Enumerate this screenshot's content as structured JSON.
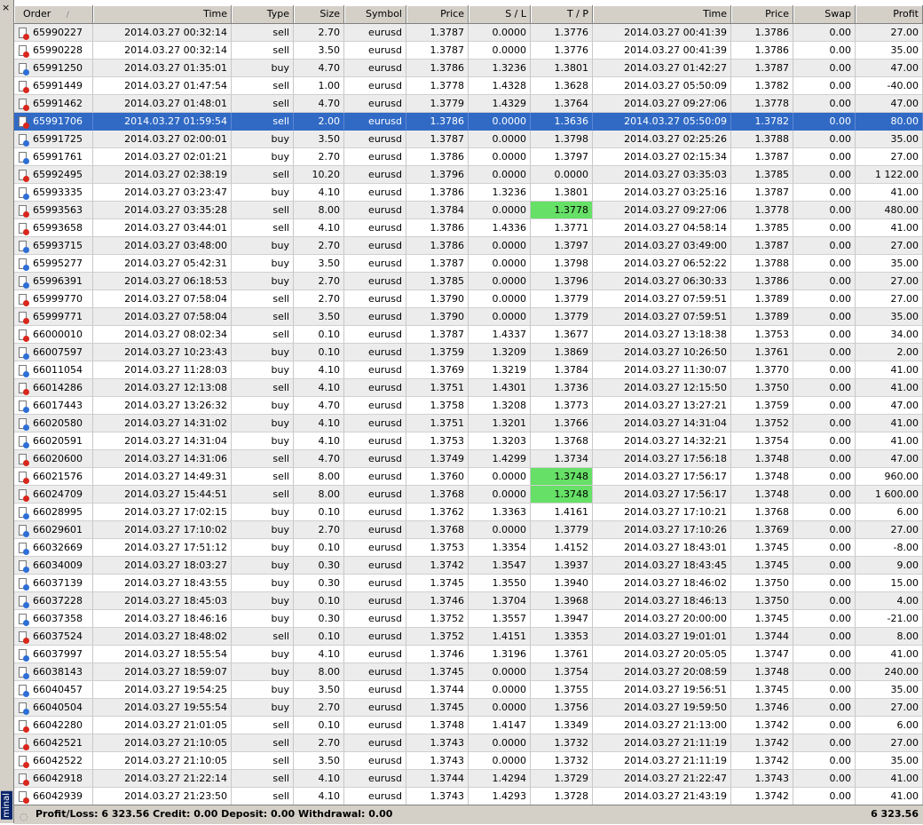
{
  "sidebar": {
    "close_glyph": "×",
    "label": "minal"
  },
  "table": {
    "headers": {
      "order": "Order",
      "sort_glyph": "/",
      "time": "Time",
      "type": "Type",
      "size": "Size",
      "symbol": "Symbol",
      "price": "Price",
      "sl": "S / L",
      "tp": "T / P",
      "close_time": "Time",
      "close_price": "Price",
      "swap": "Swap",
      "profit": "Profit"
    },
    "rows": [
      {
        "order": "65990227",
        "time": "2014.03.27 00:32:14",
        "type": "sell",
        "size": "2.70",
        "symbol": "eurusd",
        "price": "1.3787",
        "sl": "0.0000",
        "tp": "1.3776",
        "close_time": "2014.03.27 00:41:39",
        "close_price": "1.3786",
        "swap": "0.00",
        "profit": "27.00"
      },
      {
        "order": "65990228",
        "time": "2014.03.27 00:32:14",
        "type": "sell",
        "size": "3.50",
        "symbol": "eurusd",
        "price": "1.3787",
        "sl": "0.0000",
        "tp": "1.3776",
        "close_time": "2014.03.27 00:41:39",
        "close_price": "1.3786",
        "swap": "0.00",
        "profit": "35.00"
      },
      {
        "order": "65991250",
        "time": "2014.03.27 01:35:01",
        "type": "buy",
        "size": "4.70",
        "symbol": "eurusd",
        "price": "1.3786",
        "sl": "1.3236",
        "tp": "1.3801",
        "close_time": "2014.03.27 01:42:27",
        "close_price": "1.3787",
        "swap": "0.00",
        "profit": "47.00"
      },
      {
        "order": "65991449",
        "time": "2014.03.27 01:47:54",
        "type": "sell",
        "size": "1.00",
        "symbol": "eurusd",
        "price": "1.3778",
        "sl": "1.4328",
        "tp": "1.3628",
        "close_time": "2014.03.27 05:50:09",
        "close_price": "1.3782",
        "swap": "0.00",
        "profit": "-40.00"
      },
      {
        "order": "65991462",
        "time": "2014.03.27 01:48:01",
        "type": "sell",
        "size": "4.70",
        "symbol": "eurusd",
        "price": "1.3779",
        "sl": "1.4329",
        "tp": "1.3764",
        "close_time": "2014.03.27 09:27:06",
        "close_price": "1.3778",
        "swap": "0.00",
        "profit": "47.00"
      },
      {
        "order": "65991706",
        "time": "2014.03.27 01:59:54",
        "type": "sell",
        "size": "2.00",
        "symbol": "eurusd",
        "price": "1.3786",
        "sl": "0.0000",
        "tp": "1.3636",
        "close_time": "2014.03.27 05:50:09",
        "close_price": "1.3782",
        "swap": "0.00",
        "profit": "80.00",
        "selected": true
      },
      {
        "order": "65991725",
        "time": "2014.03.27 02:00:01",
        "type": "buy",
        "size": "3.50",
        "symbol": "eurusd",
        "price": "1.3787",
        "sl": "0.0000",
        "tp": "1.3798",
        "close_time": "2014.03.27 02:25:26",
        "close_price": "1.3788",
        "swap": "0.00",
        "profit": "35.00"
      },
      {
        "order": "65991761",
        "time": "2014.03.27 02:01:21",
        "type": "buy",
        "size": "2.70",
        "symbol": "eurusd",
        "price": "1.3786",
        "sl": "0.0000",
        "tp": "1.3797",
        "close_time": "2014.03.27 02:15:34",
        "close_price": "1.3787",
        "swap": "0.00",
        "profit": "27.00"
      },
      {
        "order": "65992495",
        "time": "2014.03.27 02:38:19",
        "type": "sell",
        "size": "10.20",
        "symbol": "eurusd",
        "price": "1.3796",
        "sl": "0.0000",
        "tp": "0.0000",
        "close_time": "2014.03.27 03:35:03",
        "close_price": "1.3785",
        "swap": "0.00",
        "profit": "1 122.00"
      },
      {
        "order": "65993335",
        "time": "2014.03.27 03:23:47",
        "type": "buy",
        "size": "4.10",
        "symbol": "eurusd",
        "price": "1.3786",
        "sl": "1.3236",
        "tp": "1.3801",
        "close_time": "2014.03.27 03:25:16",
        "close_price": "1.3787",
        "swap": "0.00",
        "profit": "41.00"
      },
      {
        "order": "65993563",
        "time": "2014.03.27 03:35:28",
        "type": "sell",
        "size": "8.00",
        "symbol": "eurusd",
        "price": "1.3784",
        "sl": "0.0000",
        "tp": "1.3778",
        "close_time": "2014.03.27 09:27:06",
        "close_price": "1.3778",
        "swap": "0.00",
        "profit": "480.00",
        "tp_hit": true
      },
      {
        "order": "65993658",
        "time": "2014.03.27 03:44:01",
        "type": "sell",
        "size": "4.10",
        "symbol": "eurusd",
        "price": "1.3786",
        "sl": "1.4336",
        "tp": "1.3771",
        "close_time": "2014.03.27 04:58:14",
        "close_price": "1.3785",
        "swap": "0.00",
        "profit": "41.00"
      },
      {
        "order": "65993715",
        "time": "2014.03.27 03:48:00",
        "type": "buy",
        "size": "2.70",
        "symbol": "eurusd",
        "price": "1.3786",
        "sl": "0.0000",
        "tp": "1.3797",
        "close_time": "2014.03.27 03:49:00",
        "close_price": "1.3787",
        "swap": "0.00",
        "profit": "27.00"
      },
      {
        "order": "65995277",
        "time": "2014.03.27 05:42:31",
        "type": "buy",
        "size": "3.50",
        "symbol": "eurusd",
        "price": "1.3787",
        "sl": "0.0000",
        "tp": "1.3798",
        "close_time": "2014.03.27 06:52:22",
        "close_price": "1.3788",
        "swap": "0.00",
        "profit": "35.00"
      },
      {
        "order": "65996391",
        "time": "2014.03.27 06:18:53",
        "type": "buy",
        "size": "2.70",
        "symbol": "eurusd",
        "price": "1.3785",
        "sl": "0.0000",
        "tp": "1.3796",
        "close_time": "2014.03.27 06:30:33",
        "close_price": "1.3786",
        "swap": "0.00",
        "profit": "27.00"
      },
      {
        "order": "65999770",
        "time": "2014.03.27 07:58:04",
        "type": "sell",
        "size": "2.70",
        "symbol": "eurusd",
        "price": "1.3790",
        "sl": "0.0000",
        "tp": "1.3779",
        "close_time": "2014.03.27 07:59:51",
        "close_price": "1.3789",
        "swap": "0.00",
        "profit": "27.00"
      },
      {
        "order": "65999771",
        "time": "2014.03.27 07:58:04",
        "type": "sell",
        "size": "3.50",
        "symbol": "eurusd",
        "price": "1.3790",
        "sl": "0.0000",
        "tp": "1.3779",
        "close_time": "2014.03.27 07:59:51",
        "close_price": "1.3789",
        "swap": "0.00",
        "profit": "35.00"
      },
      {
        "order": "66000010",
        "time": "2014.03.27 08:02:34",
        "type": "sell",
        "size": "0.10",
        "symbol": "eurusd",
        "price": "1.3787",
        "sl": "1.4337",
        "tp": "1.3677",
        "close_time": "2014.03.27 13:18:38",
        "close_price": "1.3753",
        "swap": "0.00",
        "profit": "34.00"
      },
      {
        "order": "66007597",
        "time": "2014.03.27 10:23:43",
        "type": "buy",
        "size": "0.10",
        "symbol": "eurusd",
        "price": "1.3759",
        "sl": "1.3209",
        "tp": "1.3869",
        "close_time": "2014.03.27 10:26:50",
        "close_price": "1.3761",
        "swap": "0.00",
        "profit": "2.00"
      },
      {
        "order": "66011054",
        "time": "2014.03.27 11:28:03",
        "type": "buy",
        "size": "4.10",
        "symbol": "eurusd",
        "price": "1.3769",
        "sl": "1.3219",
        "tp": "1.3784",
        "close_time": "2014.03.27 11:30:07",
        "close_price": "1.3770",
        "swap": "0.00",
        "profit": "41.00"
      },
      {
        "order": "66014286",
        "time": "2014.03.27 12:13:08",
        "type": "sell",
        "size": "4.10",
        "symbol": "eurusd",
        "price": "1.3751",
        "sl": "1.4301",
        "tp": "1.3736",
        "close_time": "2014.03.27 12:15:50",
        "close_price": "1.3750",
        "swap": "0.00",
        "profit": "41.00"
      },
      {
        "order": "66017443",
        "time": "2014.03.27 13:26:32",
        "type": "buy",
        "size": "4.70",
        "symbol": "eurusd",
        "price": "1.3758",
        "sl": "1.3208",
        "tp": "1.3773",
        "close_time": "2014.03.27 13:27:21",
        "close_price": "1.3759",
        "swap": "0.00",
        "profit": "47.00"
      },
      {
        "order": "66020580",
        "time": "2014.03.27 14:31:02",
        "type": "buy",
        "size": "4.10",
        "symbol": "eurusd",
        "price": "1.3751",
        "sl": "1.3201",
        "tp": "1.3766",
        "close_time": "2014.03.27 14:31:04",
        "close_price": "1.3752",
        "swap": "0.00",
        "profit": "41.00"
      },
      {
        "order": "66020591",
        "time": "2014.03.27 14:31:04",
        "type": "buy",
        "size": "4.10",
        "symbol": "eurusd",
        "price": "1.3753",
        "sl": "1.3203",
        "tp": "1.3768",
        "close_time": "2014.03.27 14:32:21",
        "close_price": "1.3754",
        "swap": "0.00",
        "profit": "41.00"
      },
      {
        "order": "66020600",
        "time": "2014.03.27 14:31:06",
        "type": "sell",
        "size": "4.70",
        "symbol": "eurusd",
        "price": "1.3749",
        "sl": "1.4299",
        "tp": "1.3734",
        "close_time": "2014.03.27 17:56:18",
        "close_price": "1.3748",
        "swap": "0.00",
        "profit": "47.00"
      },
      {
        "order": "66021576",
        "time": "2014.03.27 14:49:31",
        "type": "sell",
        "size": "8.00",
        "symbol": "eurusd",
        "price": "1.3760",
        "sl": "0.0000",
        "tp": "1.3748",
        "close_time": "2014.03.27 17:56:17",
        "close_price": "1.3748",
        "swap": "0.00",
        "profit": "960.00",
        "tp_hit": true
      },
      {
        "order": "66024709",
        "time": "2014.03.27 15:44:51",
        "type": "sell",
        "size": "8.00",
        "symbol": "eurusd",
        "price": "1.3768",
        "sl": "0.0000",
        "tp": "1.3748",
        "close_time": "2014.03.27 17:56:17",
        "close_price": "1.3748",
        "swap": "0.00",
        "profit": "1 600.00",
        "tp_hit": true
      },
      {
        "order": "66028995",
        "time": "2014.03.27 17:02:15",
        "type": "buy",
        "size": "0.10",
        "symbol": "eurusd",
        "price": "1.3762",
        "sl": "1.3363",
        "tp": "1.4161",
        "close_time": "2014.03.27 17:10:21",
        "close_price": "1.3768",
        "swap": "0.00",
        "profit": "6.00"
      },
      {
        "order": "66029601",
        "time": "2014.03.27 17:10:02",
        "type": "buy",
        "size": "2.70",
        "symbol": "eurusd",
        "price": "1.3768",
        "sl": "0.0000",
        "tp": "1.3779",
        "close_time": "2014.03.27 17:10:26",
        "close_price": "1.3769",
        "swap": "0.00",
        "profit": "27.00"
      },
      {
        "order": "66032669",
        "time": "2014.03.27 17:51:12",
        "type": "buy",
        "size": "0.10",
        "symbol": "eurusd",
        "price": "1.3753",
        "sl": "1.3354",
        "tp": "1.4152",
        "close_time": "2014.03.27 18:43:01",
        "close_price": "1.3745",
        "swap": "0.00",
        "profit": "-8.00"
      },
      {
        "order": "66034009",
        "time": "2014.03.27 18:03:27",
        "type": "buy",
        "size": "0.30",
        "symbol": "eurusd",
        "price": "1.3742",
        "sl": "1.3547",
        "tp": "1.3937",
        "close_time": "2014.03.27 18:43:45",
        "close_price": "1.3745",
        "swap": "0.00",
        "profit": "9.00"
      },
      {
        "order": "66037139",
        "time": "2014.03.27 18:43:55",
        "type": "buy",
        "size": "0.30",
        "symbol": "eurusd",
        "price": "1.3745",
        "sl": "1.3550",
        "tp": "1.3940",
        "close_time": "2014.03.27 18:46:02",
        "close_price": "1.3750",
        "swap": "0.00",
        "profit": "15.00"
      },
      {
        "order": "66037228",
        "time": "2014.03.27 18:45:03",
        "type": "buy",
        "size": "0.10",
        "symbol": "eurusd",
        "price": "1.3746",
        "sl": "1.3704",
        "tp": "1.3968",
        "close_time": "2014.03.27 18:46:13",
        "close_price": "1.3750",
        "swap": "0.00",
        "profit": "4.00"
      },
      {
        "order": "66037358",
        "time": "2014.03.27 18:46:16",
        "type": "buy",
        "size": "0.30",
        "symbol": "eurusd",
        "price": "1.3752",
        "sl": "1.3557",
        "tp": "1.3947",
        "close_time": "2014.03.27 20:00:00",
        "close_price": "1.3745",
        "swap": "0.00",
        "profit": "-21.00"
      },
      {
        "order": "66037524",
        "time": "2014.03.27 18:48:02",
        "type": "sell",
        "size": "0.10",
        "symbol": "eurusd",
        "price": "1.3752",
        "sl": "1.4151",
        "tp": "1.3353",
        "close_time": "2014.03.27 19:01:01",
        "close_price": "1.3744",
        "swap": "0.00",
        "profit": "8.00"
      },
      {
        "order": "66037997",
        "time": "2014.03.27 18:55:54",
        "type": "buy",
        "size": "4.10",
        "symbol": "eurusd",
        "price": "1.3746",
        "sl": "1.3196",
        "tp": "1.3761",
        "close_time": "2014.03.27 20:05:05",
        "close_price": "1.3747",
        "swap": "0.00",
        "profit": "41.00"
      },
      {
        "order": "66038143",
        "time": "2014.03.27 18:59:07",
        "type": "buy",
        "size": "8.00",
        "symbol": "eurusd",
        "price": "1.3745",
        "sl": "0.0000",
        "tp": "1.3754",
        "close_time": "2014.03.27 20:08:59",
        "close_price": "1.3748",
        "swap": "0.00",
        "profit": "240.00"
      },
      {
        "order": "66040457",
        "time": "2014.03.27 19:54:25",
        "type": "buy",
        "size": "3.50",
        "symbol": "eurusd",
        "price": "1.3744",
        "sl": "0.0000",
        "tp": "1.3755",
        "close_time": "2014.03.27 19:56:51",
        "close_price": "1.3745",
        "swap": "0.00",
        "profit": "35.00"
      },
      {
        "order": "66040504",
        "time": "2014.03.27 19:55:54",
        "type": "buy",
        "size": "2.70",
        "symbol": "eurusd",
        "price": "1.3745",
        "sl": "0.0000",
        "tp": "1.3756",
        "close_time": "2014.03.27 19:59:50",
        "close_price": "1.3746",
        "swap": "0.00",
        "profit": "27.00"
      },
      {
        "order": "66042280",
        "time": "2014.03.27 21:01:05",
        "type": "sell",
        "size": "0.10",
        "symbol": "eurusd",
        "price": "1.3748",
        "sl": "1.4147",
        "tp": "1.3349",
        "close_time": "2014.03.27 21:13:00",
        "close_price": "1.3742",
        "swap": "0.00",
        "profit": "6.00"
      },
      {
        "order": "66042521",
        "time": "2014.03.27 21:10:05",
        "type": "sell",
        "size": "2.70",
        "symbol": "eurusd",
        "price": "1.3743",
        "sl": "0.0000",
        "tp": "1.3732",
        "close_time": "2014.03.27 21:11:19",
        "close_price": "1.3742",
        "swap": "0.00",
        "profit": "27.00"
      },
      {
        "order": "66042522",
        "time": "2014.03.27 21:10:05",
        "type": "sell",
        "size": "3.50",
        "symbol": "eurusd",
        "price": "1.3743",
        "sl": "0.0000",
        "tp": "1.3732",
        "close_time": "2014.03.27 21:11:19",
        "close_price": "1.3742",
        "swap": "0.00",
        "profit": "35.00"
      },
      {
        "order": "66042918",
        "time": "2014.03.27 21:22:14",
        "type": "sell",
        "size": "4.10",
        "symbol": "eurusd",
        "price": "1.3744",
        "sl": "1.4294",
        "tp": "1.3729",
        "close_time": "2014.03.27 21:22:47",
        "close_price": "1.3743",
        "swap": "0.00",
        "profit": "41.00"
      },
      {
        "order": "66042939",
        "time": "2014.03.27 21:23:50",
        "type": "sell",
        "size": "4.10",
        "symbol": "eurusd",
        "price": "1.3743",
        "sl": "1.4293",
        "tp": "1.3728",
        "close_time": "2014.03.27 21:43:19",
        "close_price": "1.3742",
        "swap": "0.00",
        "profit": "41.00"
      }
    ]
  },
  "footer": {
    "summary": "Profit/Loss: 6 323.56  Credit: 0.00  Deposit: 0.00  Withdrawal: 0.00",
    "total": "6 323.56"
  },
  "colors": {
    "selected_row": "#316ac5",
    "tp_hit": "#66e066",
    "sell_icon": "#d9271d",
    "buy_icon": "#2d6fd6"
  }
}
